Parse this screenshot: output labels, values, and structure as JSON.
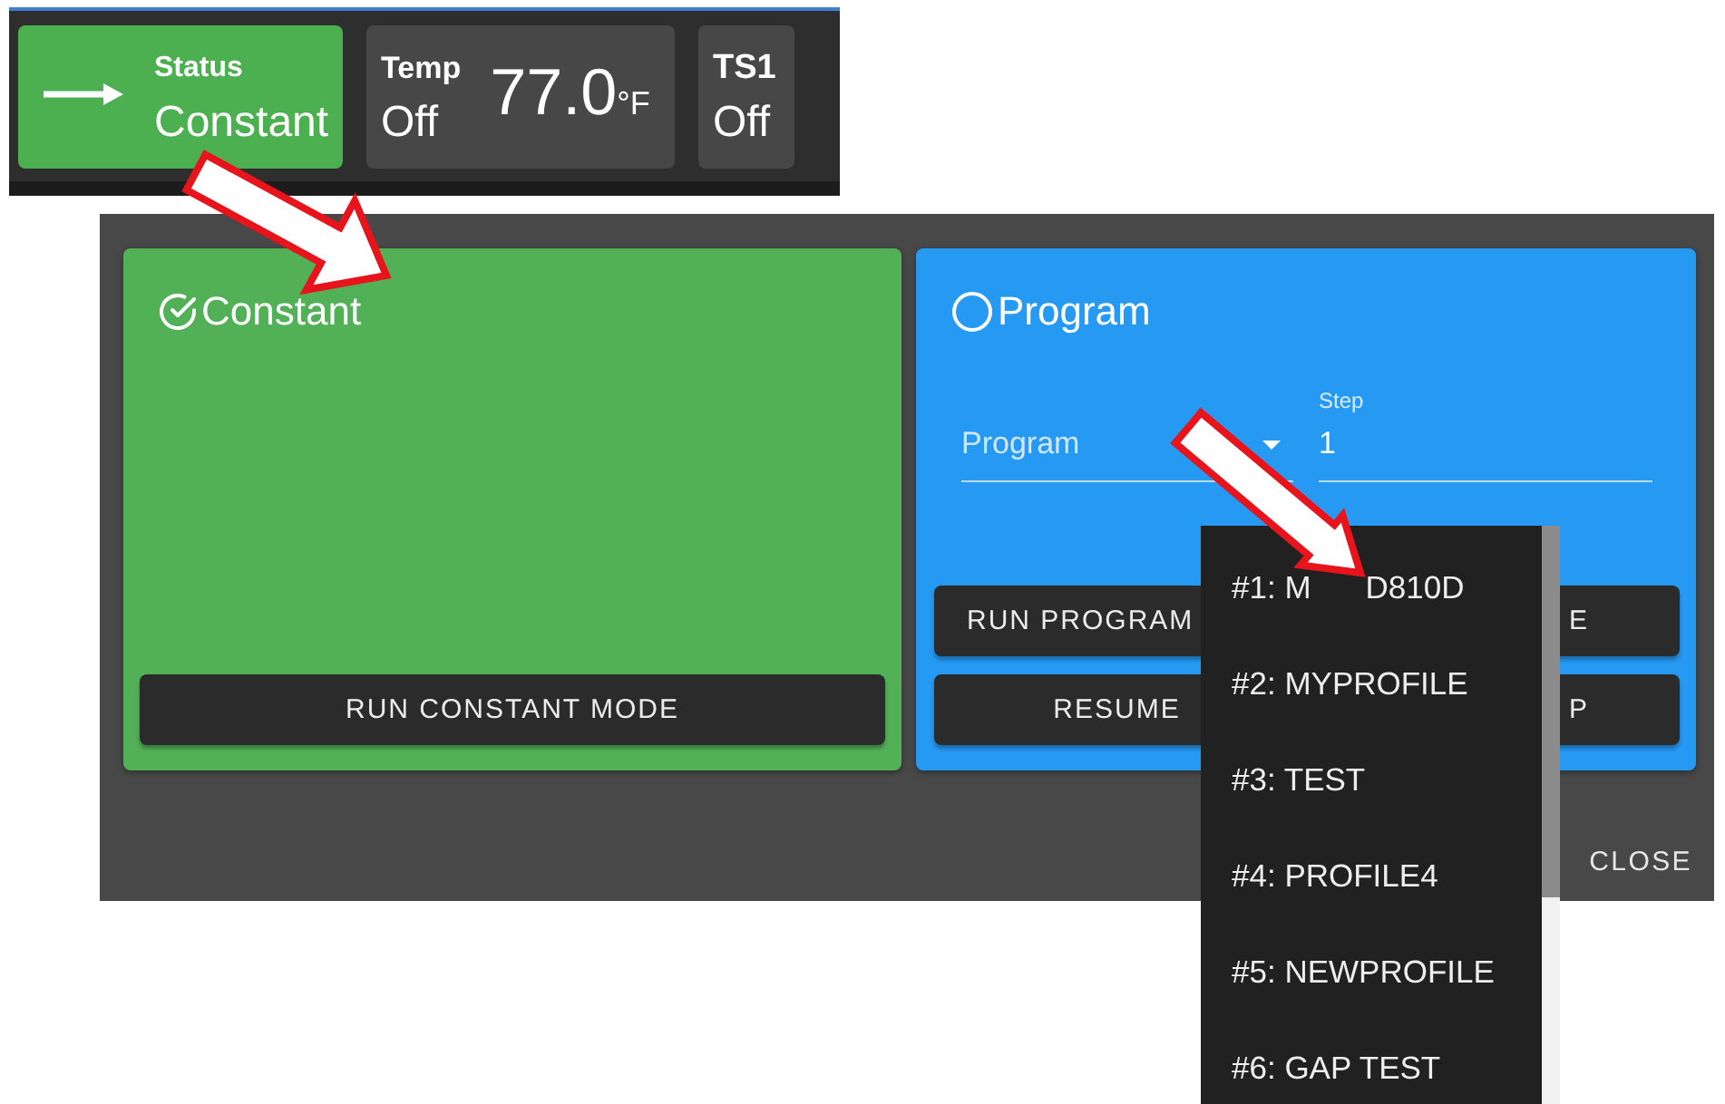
{
  "status_bar": {
    "tiles": [
      {
        "kind": "status",
        "label": "Status",
        "value": "Constant",
        "color": "#4caf50"
      },
      {
        "kind": "temperature",
        "label": "Temp",
        "value": "Off",
        "reading": "77.0",
        "unit": "°F",
        "color": "#474747"
      },
      {
        "kind": "sensor",
        "label": "TS1",
        "value": "Off",
        "color": "#474747"
      }
    ]
  },
  "dialog": {
    "modes": [
      {
        "kind": "constant",
        "title": "Constant",
        "selected": true,
        "color": "#52b157",
        "buttons": [
          {
            "label": "RUN CONSTANT MODE"
          }
        ]
      },
      {
        "kind": "program",
        "title": "Program",
        "selected": false,
        "color": "#2699f2",
        "select": {
          "placeholder": "Program"
        },
        "step": {
          "label": "Step",
          "value": "1"
        },
        "buttons": [
          {
            "label": "RUN PROGRAM"
          },
          {
            "label": "E"
          },
          {
            "label": "RESUME"
          },
          {
            "label": "P"
          }
        ]
      }
    ],
    "close": "CLOSE"
  },
  "dropdown": {
    "items": [
      {
        "label": "#1: M",
        "label_end": "D810D",
        "selected": false
      },
      {
        "label": "#2: MYPROFILE",
        "selected": false
      },
      {
        "label": "#3: TEST",
        "selected": false
      },
      {
        "label": "#4: PROFILE4",
        "selected": false
      },
      {
        "label": "#5: NEWPROFILE",
        "selected": false
      },
      {
        "label": "#6: GAP TEST",
        "selected": false
      }
    ]
  }
}
